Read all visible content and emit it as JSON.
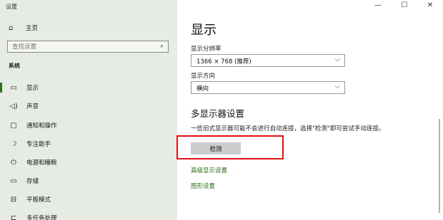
{
  "window": {
    "title": "设置",
    "controls": [
      "—",
      "☐",
      "✕"
    ]
  },
  "sidebar": {
    "home_label": "主页",
    "search_placeholder": "查找设置",
    "section_title": "系统",
    "items": [
      {
        "label": "显示",
        "icon": "monitor-icon",
        "glyph": "☐",
        "active": true
      },
      {
        "label": "声音",
        "icon": "speaker-icon",
        "glyph": "🕪",
        "active": false
      },
      {
        "label": "通知和操作",
        "icon": "notification-icon",
        "glyph": "▭",
        "active": false
      },
      {
        "label": "专注助手",
        "icon": "moon-icon",
        "glyph": "☽",
        "active": false
      },
      {
        "label": "电源和睡眠",
        "icon": "power-icon",
        "glyph": "⏻",
        "active": false
      },
      {
        "label": "存储",
        "icon": "storage-icon",
        "glyph": "▭",
        "active": false
      },
      {
        "label": "平板模式",
        "icon": "tablet-icon",
        "glyph": "⊟",
        "active": false
      },
      {
        "label": "多任务处理",
        "icon": "multitask-icon",
        "glyph": "⊏",
        "active": false
      }
    ]
  },
  "main": {
    "title": "显示",
    "resolution": {
      "label": "显示分辨率",
      "value": "1366 × 768 (推荐)"
    },
    "orientation": {
      "label": "显示方向",
      "value": "横向"
    },
    "multi_display": {
      "title": "多显示器设置",
      "description": "一些旧式显示器可能不会进行自动连接，选择\"检测\"即可尝试手动连接。",
      "detect_button": "检测"
    },
    "links": {
      "advanced": "高级显示设置",
      "graphics": "图形设置"
    }
  },
  "colors": {
    "sidebar_bg": "#e6ebe3",
    "accent": "#2d6f1a",
    "highlight_box": "#e01010"
  }
}
